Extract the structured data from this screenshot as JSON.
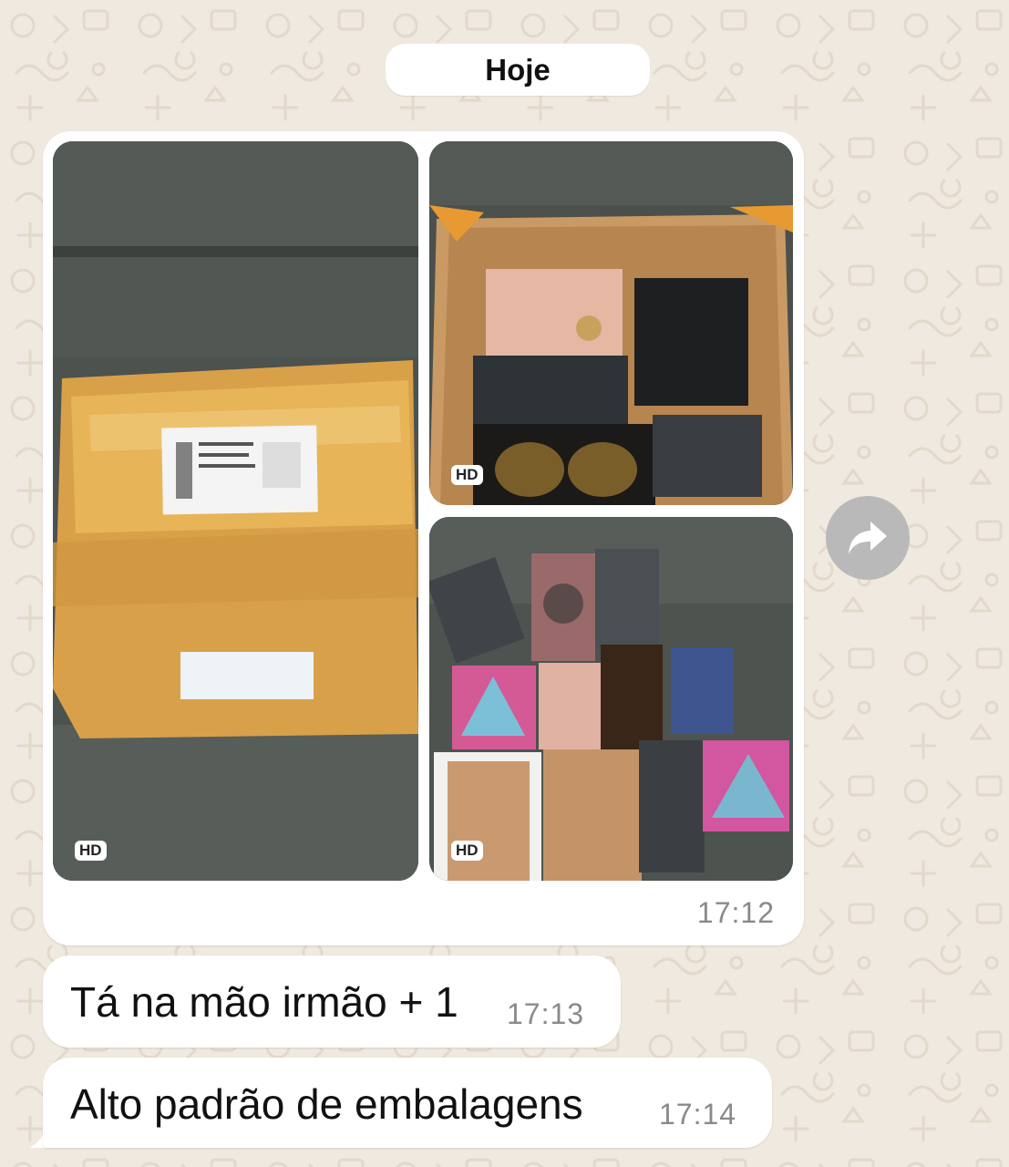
{
  "chat": {
    "date_label": "Hoje",
    "media_message": {
      "photos": [
        {
          "icon": "package-photo",
          "badge": "HD"
        },
        {
          "icon": "open-box-photo",
          "badge": "HD"
        },
        {
          "icon": "items-photo",
          "badge": "HD"
        }
      ],
      "time": "17:12"
    },
    "messages": [
      {
        "text": "Tá na mão irmão + 1",
        "time": "17:13"
      },
      {
        "text": "Alto padrão de embalagens",
        "time": "17:14"
      }
    ],
    "forward_icon": "forward-icon"
  },
  "colors": {
    "wallpaper": "#efe9df",
    "bubble": "#ffffff",
    "timestamp": "#8a8a8a",
    "forward_button": "#b9b9b9"
  }
}
